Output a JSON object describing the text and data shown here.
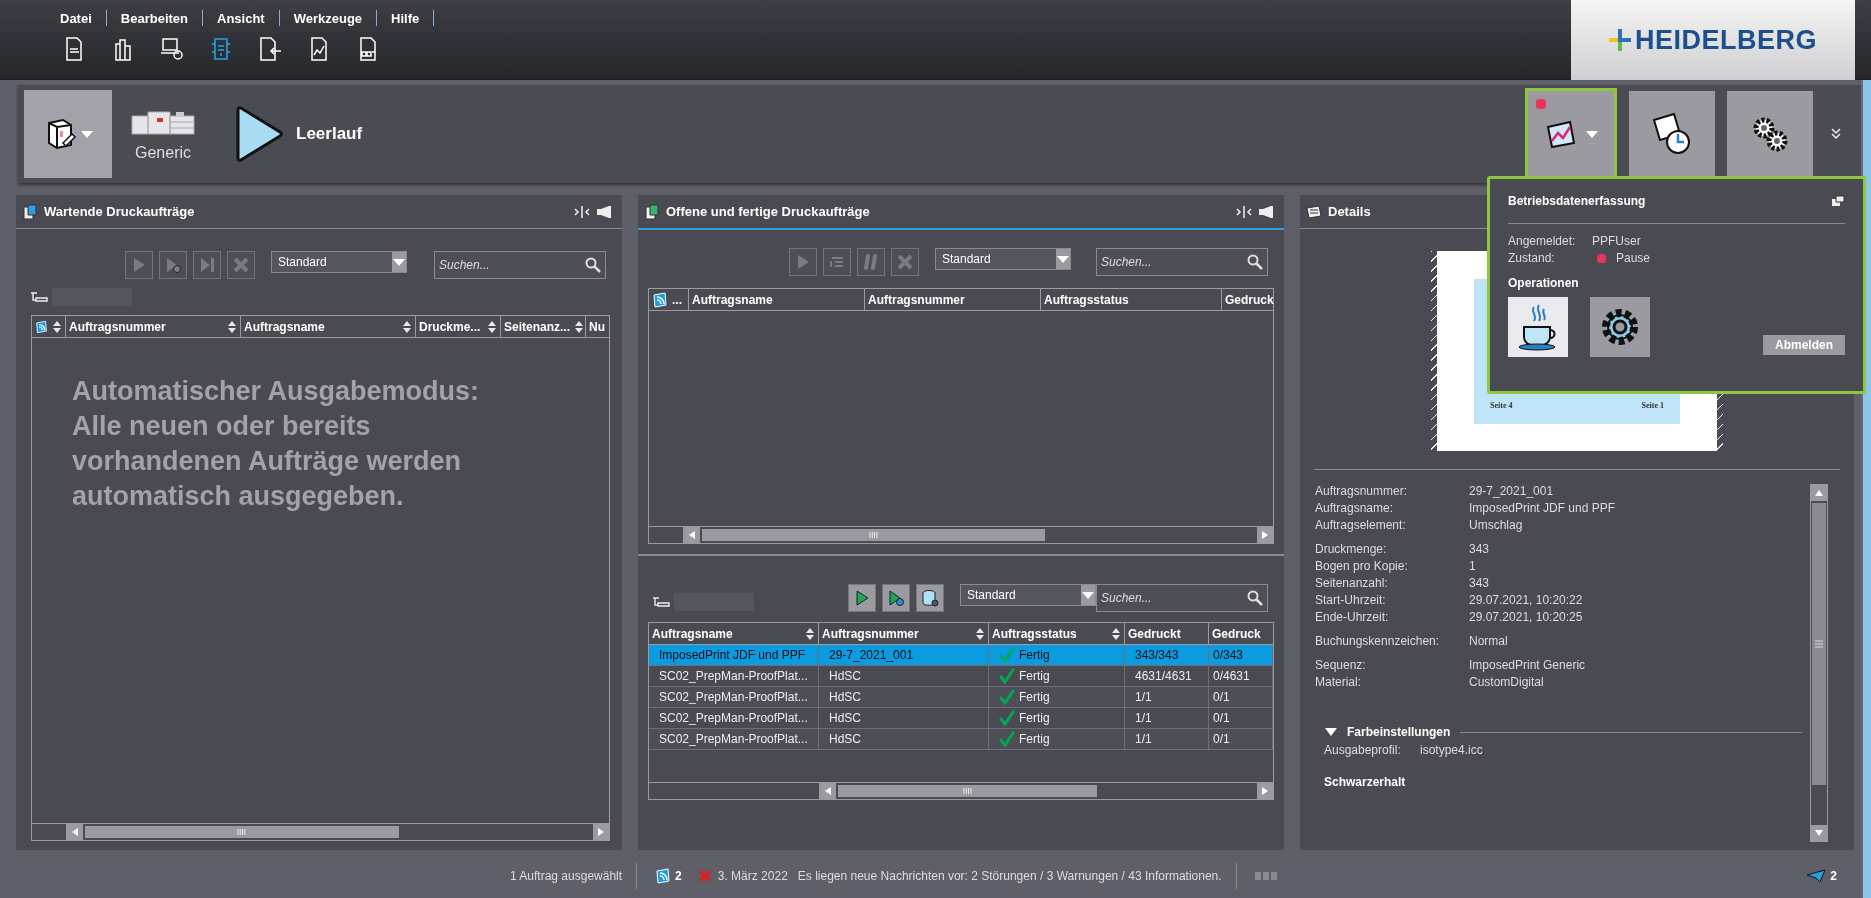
{
  "menu": [
    "Datei",
    "Bearbeiten",
    "Ansicht",
    "Werkzeuge",
    "Hilfe"
  ],
  "tools": [
    {
      "kind": "document",
      "selected": false
    },
    {
      "kind": "stack",
      "selected": false
    },
    {
      "kind": "computer-gear",
      "selected": false
    },
    {
      "kind": "machine",
      "selected": true
    },
    {
      "kind": "document-import",
      "selected": false
    },
    {
      "kind": "chart-document",
      "selected": false
    },
    {
      "kind": "document-sequence",
      "selected": false
    }
  ],
  "logo": {
    "text": "HEIDELBERG"
  },
  "device": {
    "name": "Generic",
    "status": "Leerlauf"
  },
  "quick_buttons": [
    {
      "kind": "chart",
      "selected": true,
      "alert": true
    },
    {
      "kind": "clock",
      "selected": false,
      "alert": false
    },
    {
      "kind": "gears",
      "selected": false,
      "alert": false
    }
  ],
  "waiting_panel": {
    "title": "Wartende Druckaufträge",
    "buttons": [
      {
        "kind": "play",
        "disabled": true
      },
      {
        "kind": "play-settings",
        "disabled": true
      },
      {
        "kind": "skip-end",
        "disabled": true
      },
      {
        "kind": "cancel",
        "disabled": true
      }
    ],
    "filter": "Standard",
    "search_placeholder": "Suchen...",
    "columns": [
      {
        "kind": "icon",
        "sortable": true
      },
      {
        "label": "Auftragsnummer",
        "sortable": true
      },
      {
        "label": "Auftragsname",
        "sortable": true
      },
      {
        "label": "Druckme...",
        "sortable": true
      },
      {
        "label": "Seitenanz...",
        "sortable": true
      },
      {
        "label": "Nu"
      }
    ],
    "message": "Automatischer Ausgabemodus: Alle neuen oder bereits vorhandenen Aufträge werden automatisch ausgegeben."
  },
  "open_panel": {
    "title": "Offene und fertige Druckaufträge",
    "buttons": [
      {
        "kind": "play",
        "disabled": true
      },
      {
        "kind": "list",
        "disabled": true
      },
      {
        "kind": "pause",
        "disabled": true
      },
      {
        "kind": "cancel",
        "disabled": true
      }
    ],
    "filter": "Standard",
    "search_placeholder": "Suchen...",
    "columns": [
      {
        "kind": "icon",
        "label": "...",
        "sortable": false
      },
      {
        "label": "Auftragsname",
        "sortable": false
      },
      {
        "label": "Auftragsnummer",
        "sortable": false
      },
      {
        "label": "Auftragsstatus",
        "sortable": false
      },
      {
        "label": "Gedruck"
      }
    ]
  },
  "done_panel": {
    "buttons": [
      {
        "kind": "play",
        "disabled": false
      },
      {
        "kind": "play-settings",
        "disabled": false
      },
      {
        "kind": "database",
        "disabled": false
      }
    ],
    "filter": "Standard",
    "search_placeholder": "Suchen...",
    "columns": [
      {
        "label": "Auftragsname",
        "sortable": true
      },
      {
        "label": "Auftragsnummer",
        "sortable": true
      },
      {
        "label": "Auftragsstatus",
        "sortable": true
      },
      {
        "label": "Gedruckt",
        "sortable": false
      },
      {
        "label": "Gedruck",
        "sortable": false
      }
    ],
    "rows": [
      {
        "selected": true,
        "cells": [
          "ImposedPrint JDF und PPF",
          "29-7_2021_001",
          "Fertig",
          "343/343",
          "0/343"
        ]
      },
      {
        "selected": false,
        "cells": [
          "SC02_PrepMan-ProofPlat...",
          "HdSC",
          "Fertig",
          "4631/4631",
          "0/4631"
        ]
      },
      {
        "selected": false,
        "cells": [
          "SC02_PrepMan-ProofPlat...",
          "HdSC",
          "Fertig",
          "1/1",
          "0/1"
        ]
      },
      {
        "selected": false,
        "cells": [
          "SC02_PrepMan-ProofPlat...",
          "HdSC",
          "Fertig",
          "1/1",
          "0/1"
        ]
      },
      {
        "selected": false,
        "cells": [
          "SC02_PrepMan-ProofPlat...",
          "HdSC",
          "Fertig",
          "1/1",
          "0/1"
        ]
      }
    ]
  },
  "details": {
    "title": "Details",
    "preview": {
      "left_label": "Seite 4",
      "right_label": "Seite 1"
    },
    "groups": [
      [
        {
          "label": "Auftragsnummer:",
          "value": "29-7_2021_001"
        },
        {
          "label": "Auftragsname:",
          "value": "ImposedPrint JDF und PPF"
        },
        {
          "label": "Auftragselement:",
          "value": "Umschlag"
        }
      ],
      [
        {
          "label": "Druckmenge:",
          "value": "343"
        },
        {
          "label": "Bogen pro Kopie:",
          "value": "1"
        },
        {
          "label": "Seitenanzahl:",
          "value": "343"
        },
        {
          "label": "Start-Uhrzeit:",
          "value": "29.07.2021, 10:20:22"
        },
        {
          "label": "Ende-Uhrzeit:",
          "value": "29.07.2021, 10:20:25"
        }
      ],
      [
        {
          "label": "Buchungskennzeichen:",
          "value": "Normal"
        }
      ],
      [
        {
          "label": "Sequenz:",
          "value": "ImposedPrint Generic"
        },
        {
          "label": "Material:",
          "value": "CustomDigital"
        }
      ]
    ],
    "section": {
      "title": "Farbeinstellungen",
      "expanded": true,
      "fields": [
        {
          "label": "Ausgabeprofil:",
          "value": "isotype4.icc"
        }
      ]
    },
    "subsection": "Schwarzerhalt"
  },
  "popup": {
    "title": "Betriebsdatenerfassung",
    "fields": [
      {
        "label": "Angemeldet:",
        "value": "PPFUser"
      },
      {
        "label": "Zustand:",
        "value": "Pause",
        "color": "#e8365a"
      }
    ],
    "operations_title": "Operationen",
    "operations": [
      {
        "kind": "break"
      },
      {
        "kind": "settings"
      }
    ],
    "logout": "Abmelden"
  },
  "status_bar": {
    "selection": "1 Auftrag ausgewählt",
    "feed_count": "2",
    "date": "3. März 2022",
    "message": "Es liegen neue Nachrichten vor: 2 Störungen / 3 Warnungen / 43 Informationen.",
    "send_count": "2"
  }
}
